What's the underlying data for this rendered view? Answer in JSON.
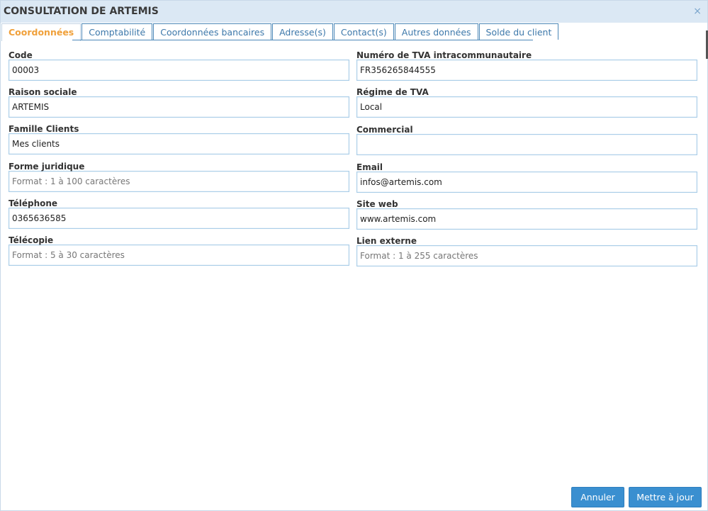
{
  "window": {
    "title": "CONSULTATION DE ARTEMIS",
    "close_glyph": "×"
  },
  "tabs": [
    {
      "label": "Coordonnées",
      "active": true
    },
    {
      "label": "Comptabilité",
      "active": false
    },
    {
      "label": "Coordonnées bancaires",
      "active": false
    },
    {
      "label": "Adresse(s)",
      "active": false
    },
    {
      "label": "Contact(s)",
      "active": false
    },
    {
      "label": "Autres données",
      "active": false
    },
    {
      "label": "Solde du client",
      "active": false
    }
  ],
  "fields": {
    "code": {
      "label": "Code",
      "value": "00003",
      "placeholder": ""
    },
    "raison_sociale": {
      "label": "Raison sociale",
      "value": "ARTEMIS",
      "placeholder": ""
    },
    "famille_clients": {
      "label": "Famille Clients",
      "value": "Mes clients",
      "placeholder": ""
    },
    "forme_juridique": {
      "label": "Forme juridique",
      "value": "",
      "placeholder": "Format : 1 à 100 caractères"
    },
    "telephone": {
      "label": "Téléphone",
      "value": "0365636585",
      "placeholder": ""
    },
    "telecopie": {
      "label": "Télécopie",
      "value": "",
      "placeholder": "Format : 5 à 30 caractères"
    },
    "tva_intra": {
      "label": "Numéro de TVA intracommunautaire",
      "value": "FR356265844555",
      "placeholder": ""
    },
    "regime_tva": {
      "label": "Régime de TVA",
      "value": "Local",
      "placeholder": ""
    },
    "commercial": {
      "label": "Commercial",
      "value": "",
      "placeholder": ""
    },
    "email": {
      "label": "Email",
      "value": "infos@artemis.com",
      "placeholder": ""
    },
    "site_web": {
      "label": "Site web",
      "value": "www.artemis.com",
      "placeholder": ""
    },
    "lien_externe": {
      "label": "Lien externe",
      "value": "",
      "placeholder": "Format : 1 à 255 caractères"
    }
  },
  "buttons": {
    "cancel": "Annuler",
    "update": "Mettre à jour"
  },
  "colors": {
    "accent": "#3a8fd0",
    "active_tab": "#f0a03a",
    "tab_text": "#3d78aa",
    "titlebar": "#dbe8f4"
  }
}
